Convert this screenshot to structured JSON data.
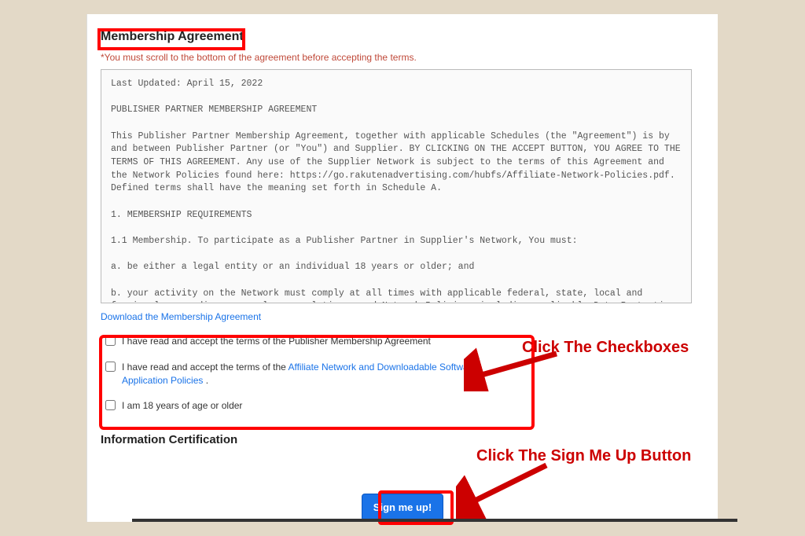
{
  "section_title": "Membership Agreement",
  "warning": "*You must scroll to the bottom of the agreement before accepting the terms.",
  "agreement_text": "Last Updated: April 15, 2022\n\nPUBLISHER PARTNER MEMBERSHIP AGREEMENT\n\nThis Publisher Partner Membership Agreement, together with applicable Schedules (the \"Agreement\") is by and between Publisher Partner (or \"You\") and Supplier. BY CLICKING ON THE ACCEPT BUTTON, YOU AGREE TO THE TERMS OF THIS AGREEMENT. Any use of the Supplier Network is subject to the terms of this Agreement and the Network Policies found here: https://go.rakutenadvertising.com/hubfs/Affiliate-Network-Policies.pdf. Defined terms shall have the meaning set forth in Schedule A.\n\n1. MEMBERSHIP REQUIREMENTS\n\n1.1 Membership. To participate as a Publisher Partner in Supplier's Network, You must:\n\na. be either a legal entity or an individual 18 years or older; and\n\nb. your activity on the Network must comply at all times with applicable federal, state, local and foreign laws, ordinances, rules, regulations, and Network Policies, including applicable Data Protection Laws.",
  "download_label": "Download the Membership Agreement",
  "checkboxes": {
    "c1": "I have read and accept the terms of the Publisher Membership Agreement",
    "c2_pre": "I have read and accept the terms of the ",
    "c2_link": "Affiliate Network and Downloadable Software Application Policies",
    "c2_post": " .",
    "c3": "I am 18 years of age or older"
  },
  "info_cert": "Information Certification",
  "signup_label": "Sign me up!",
  "annotations": {
    "a1": "Click The Checkboxes",
    "a2": "Click The Sign Me Up Button"
  }
}
